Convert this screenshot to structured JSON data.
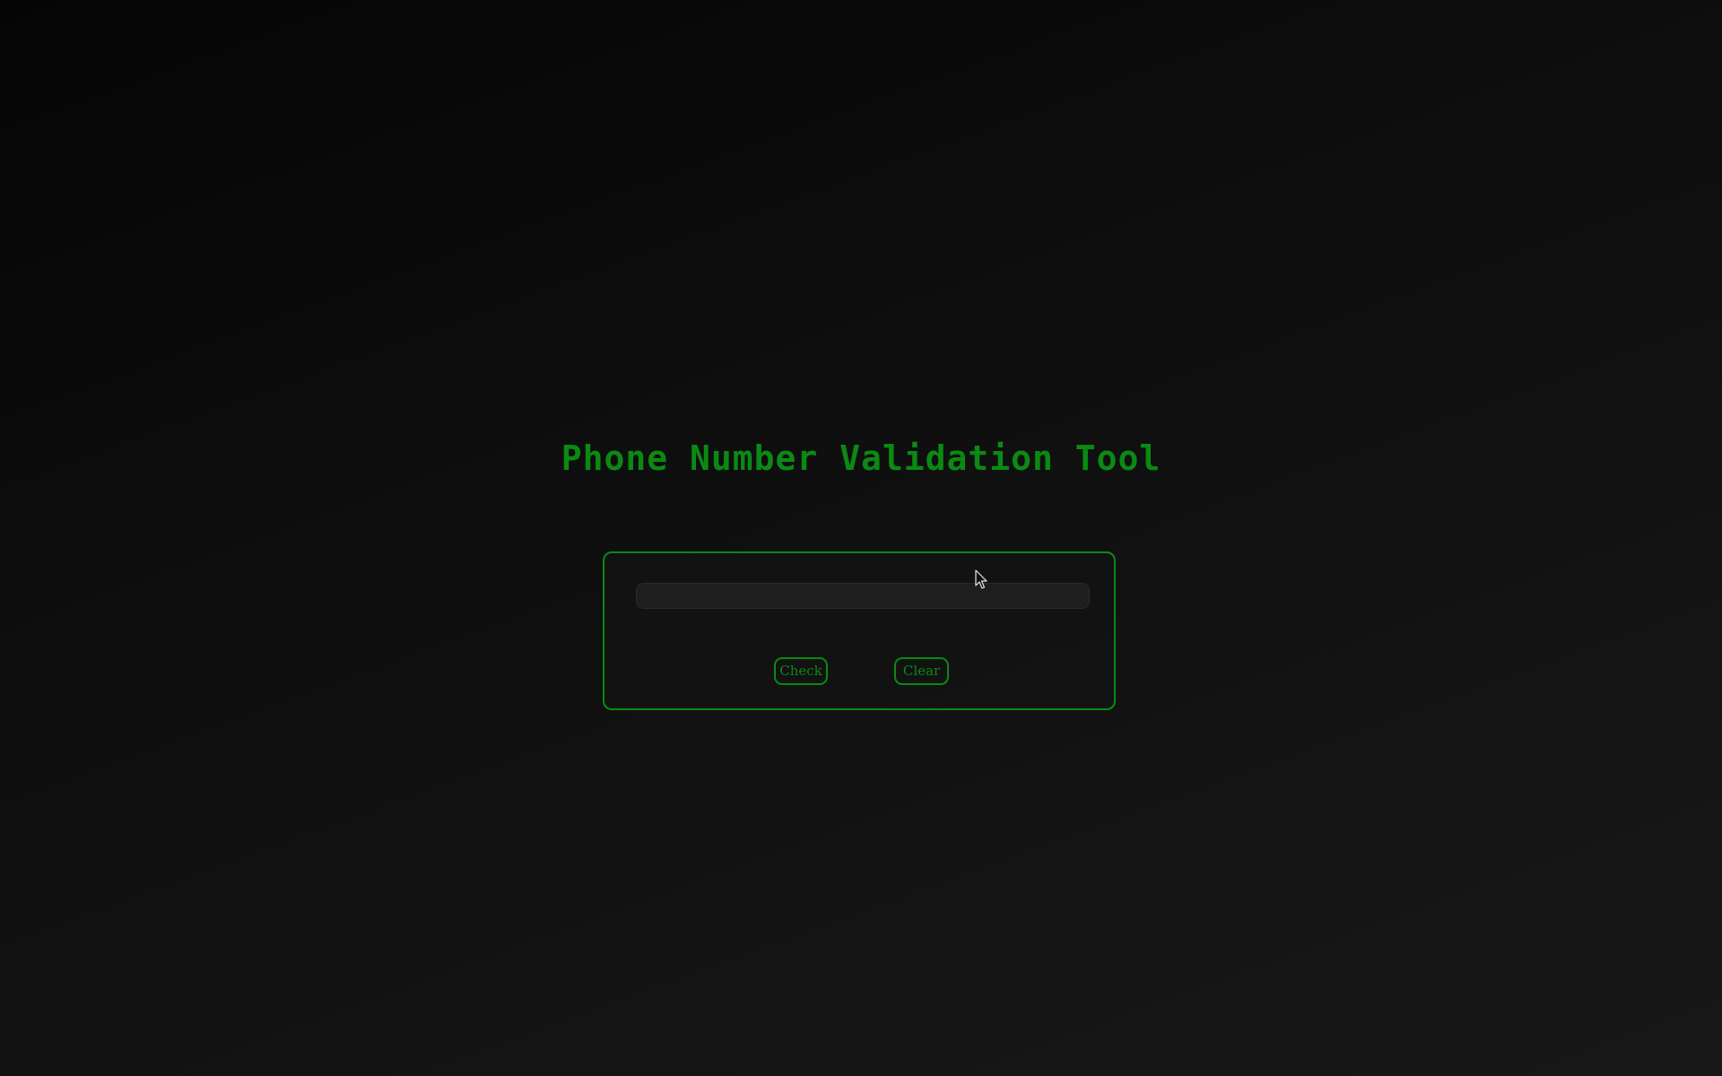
{
  "page": {
    "title": "Phone Number Validation Tool"
  },
  "form": {
    "input_value": "",
    "input_placeholder": "",
    "check_label": "Check",
    "clear_label": "Clear"
  },
  "colors": {
    "accent": "#0a8a12",
    "background": "#121212",
    "input_background": "#1e1e1e"
  },
  "icons": {
    "cursor": "mouse-pointer-icon"
  }
}
